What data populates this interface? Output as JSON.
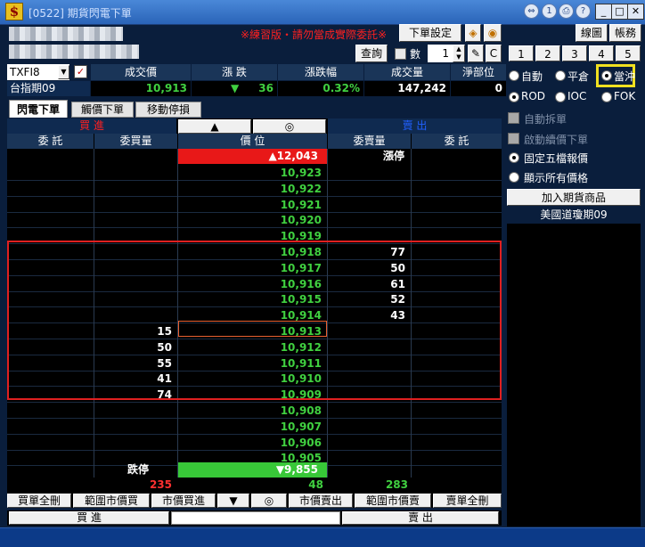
{
  "window": {
    "title": "[0522] 期貨閃電下單"
  },
  "warning": "※練習版・請勿當成實際委託※",
  "toolbar": {
    "order_settings": "下單設定",
    "query": "查詢",
    "qty_label": "數",
    "qty_value": "1",
    "c_label": "C",
    "line_chart": "線圖",
    "account": "帳務"
  },
  "quick_qty": [
    "1",
    "2",
    "3",
    "4",
    "5"
  ],
  "symbol": {
    "code": "TXFI8",
    "name": "台指期09"
  },
  "quote_headers": [
    "成交價",
    "漲 跌",
    "漲跌幅",
    "成交量",
    "淨部位"
  ],
  "quote_values": {
    "price": "10,913",
    "change": "36",
    "pct": "0.32%",
    "volume": "147,242",
    "position": "0"
  },
  "tabs": [
    "閃電下單",
    "觸價下單",
    "移動停損"
  ],
  "ladder": {
    "buy_title": "買 進",
    "sell_title": "賣 出",
    "headers": [
      "委 託",
      "委買量",
      "價 位",
      "委賣量",
      "委 託"
    ],
    "top_price": "▲12,043",
    "top_label": "漲停",
    "rows": [
      {
        "price": "10,923",
        "bid": "",
        "ask": ""
      },
      {
        "price": "10,922",
        "bid": "",
        "ask": ""
      },
      {
        "price": "10,921",
        "bid": "",
        "ask": ""
      },
      {
        "price": "10,920",
        "bid": "",
        "ask": ""
      },
      {
        "price": "10,919",
        "bid": "",
        "ask": ""
      },
      {
        "price": "10,918",
        "bid": "",
        "ask": "77"
      },
      {
        "price": "10,917",
        "bid": "",
        "ask": "50"
      },
      {
        "price": "10,916",
        "bid": "",
        "ask": "61"
      },
      {
        "price": "10,915",
        "bid": "",
        "ask": "52"
      },
      {
        "price": "10,914",
        "bid": "",
        "ask": "43"
      },
      {
        "price": "10,913",
        "bid": "15",
        "ask": ""
      },
      {
        "price": "10,912",
        "bid": "50",
        "ask": ""
      },
      {
        "price": "10,911",
        "bid": "55",
        "ask": ""
      },
      {
        "price": "10,910",
        "bid": "41",
        "ask": ""
      },
      {
        "price": "10,909",
        "bid": "74",
        "ask": ""
      },
      {
        "price": "10,908",
        "bid": "",
        "ask": ""
      },
      {
        "price": "10,907",
        "bid": "",
        "ask": ""
      },
      {
        "price": "10,906",
        "bid": "",
        "ask": ""
      },
      {
        "price": "10,905",
        "bid": "",
        "ask": ""
      }
    ],
    "bottom_label": "跌停",
    "bottom_price": "▼9,855",
    "totals": {
      "buy_orders": "235",
      "mid": "48",
      "sell_total": "283"
    }
  },
  "bottom_buttons": [
    "買單全刪",
    "範圍市價買",
    "市價買進",
    "▼",
    "◎",
    "市價賣出",
    "範圍市價賣",
    "賣單全刪"
  ],
  "bottom_bar": {
    "buy": "買 進",
    "sell": "賣 出"
  },
  "options": {
    "radio_row1": [
      "自動",
      "平倉",
      "當沖"
    ],
    "radio_row2": [
      "ROD",
      "IOC",
      "FOK"
    ],
    "auto_split": "自動拆單",
    "trailing": "啟動續價下單",
    "fixed_five": "固定五檔報價",
    "show_all": "顯示所有價格",
    "add_futures": "加入期貨商品",
    "watch_item": "美國道瓊期09"
  }
}
